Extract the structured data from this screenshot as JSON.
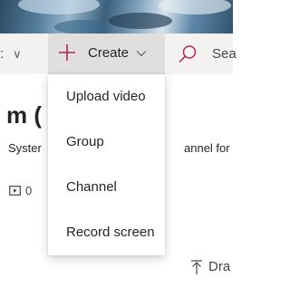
{
  "command_bar": {
    "cut_item_label": ":",
    "create_label": "Create",
    "search_placeholder": "Sea"
  },
  "background_page": {
    "title_fragment": "m (",
    "description_left": "Syster",
    "description_right": "annel for",
    "video_count": "0",
    "drag_text": "Dra"
  },
  "create_menu": {
    "items": [
      {
        "label": "Upload video"
      },
      {
        "label": "Group"
      },
      {
        "label": "Channel"
      },
      {
        "label": "Record screen"
      }
    ]
  },
  "colors": {
    "accent": "#b4245c",
    "command_bar_bg": "#f3f2f1",
    "create_button_active_bg": "#e1dfdd",
    "menu_bg": "#ffffff"
  }
}
